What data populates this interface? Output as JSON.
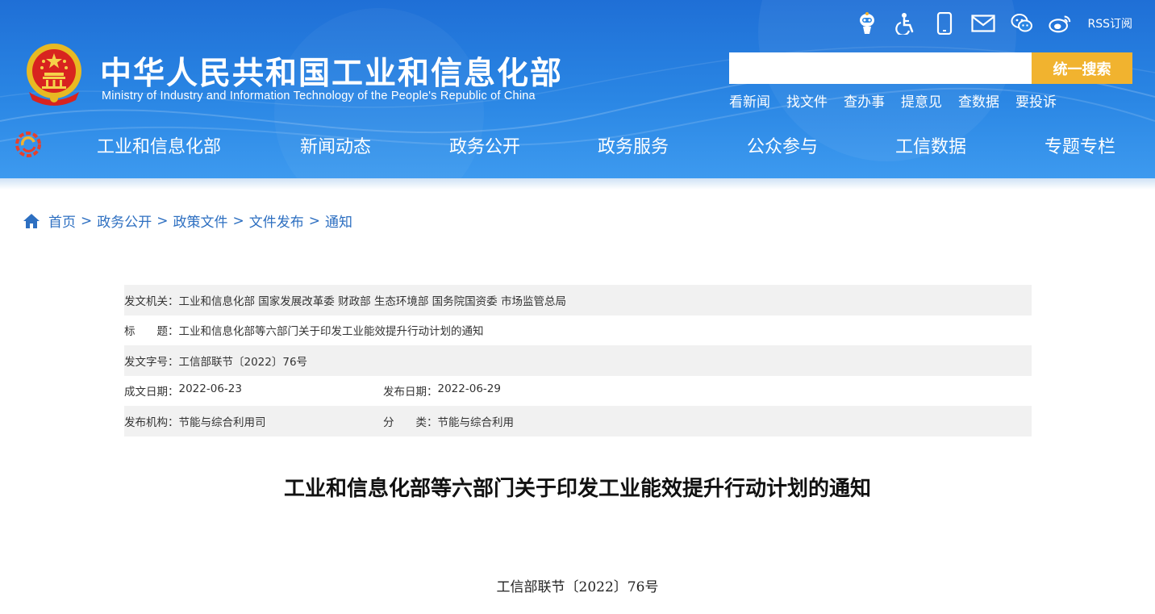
{
  "header": {
    "title": "中华人民共和国工业和信息化部",
    "subtitle": "Ministry of Industry and Information Technology of the People's Republic of China",
    "top_icons": [
      {
        "name": "robot-assistant-icon"
      },
      {
        "name": "accessibility-icon"
      },
      {
        "name": "mobile-icon"
      },
      {
        "name": "mail-icon"
      },
      {
        "name": "wechat-icon"
      },
      {
        "name": "weibo-icon"
      }
    ],
    "rss_label": "RSS订阅",
    "search": {
      "placeholder": "",
      "button_label": "统一搜索"
    },
    "quick_links": [
      "看新闻",
      "找文件",
      "查办事",
      "提意见",
      "查数据",
      "要投诉"
    ],
    "nav": [
      "工业和信息化部",
      "新闻动态",
      "政务公开",
      "政务服务",
      "公众参与",
      "工信数据",
      "专题专栏"
    ]
  },
  "colors": {
    "header_blue": "#2a86e4",
    "search_button": "#f1b32f",
    "link_blue": "#2d6fc1",
    "row_shade": "#f1f1f1"
  },
  "breadcrumb": [
    "首页",
    "政务公开",
    "政策文件",
    "文件发布",
    "通知"
  ],
  "info": {
    "issuer_label": "发文机关：",
    "issuer": "工业和信息化部 国家发展改革委 财政部 生态环境部 国务院国资委 市场监管总局",
    "title_label": "标　　题：",
    "title": "工业和信息化部等六部门关于印发工业能效提升行动计划的通知",
    "docno_label": "发文字号：",
    "docno": "工信部联节〔2022〕76号",
    "created_label": "成文日期：",
    "created": "2022-06-23",
    "published_label": "发布日期：",
    "published": "2022-06-29",
    "org_label": "发布机构：",
    "org": "节能与综合利用司",
    "category_label": "分　　类：",
    "category": "节能与综合利用"
  },
  "article": {
    "title": "工业和信息化部等六部门关于印发工业能效提升行动计划的通知",
    "doc_number": "工信部联节〔2022〕76号"
  }
}
